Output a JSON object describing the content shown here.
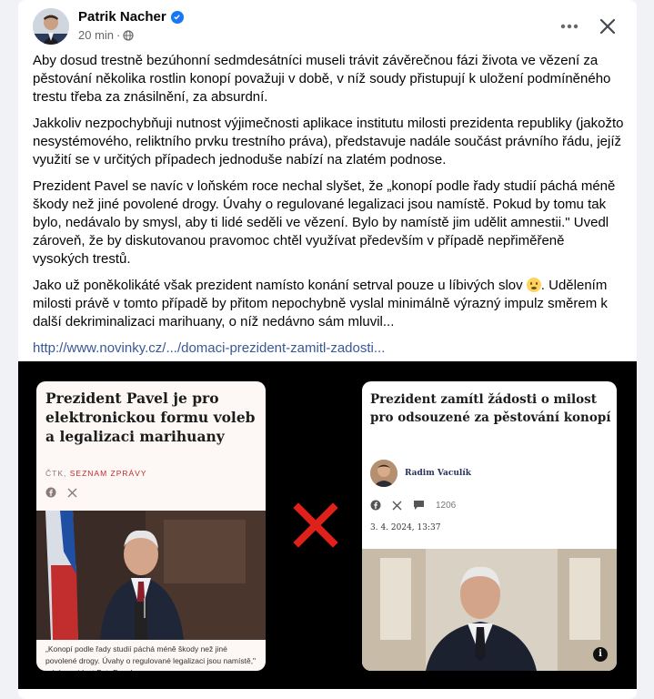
{
  "post": {
    "author": "Patrik Nacher",
    "time": "20 min",
    "meta_separator": "·",
    "paragraphs": [
      "Aby dosud trestně bezúhonní sedmdesátníci museli trávit závěrečnou fázi života ve vězení za pěstování několika rostlin konopí považuji v době, v níž soudy přistupují k uložení podmíněného trestu třeba za znásilnění, za absurdní.",
      "Jakkoliv nezpochybňuji nutnost výjimečnosti aplikace institutu milosti prezidenta republiky (jakožto nesystémového, reliktního prvku trestního práva), představuje nadále součást právního řádu, jejíž využití se v určitých případech jednoduše nabízí na zlatém podnose.",
      "Prezident Pavel se navíc v loňském roce nechal slyšet, že „konopí podle řady studií páchá méně škody než jiné povolené drogy. Úvahy o regulované legalizaci jsou namístě. Pokud by tomu tak bylo, nedávalo by smysl, aby ti lidé seděli ve vězení. Bylo by namístě jim udělit amnestii.\" Uvedl zároveň, že by diskutovanou pravomoc chtěl využívat především v případě nepřiměřeně vysokých trestů."
    ],
    "paragraph4_a": "Jako už poněkolikáté však prezident namísto konání setrval pouze u líbivých slov ",
    "paragraph4_b": ". Udělením milosti právě v tomto případě by přitom nepochybně vyslal minimálně výrazný impulz směrem k další dekriminalizaci marihuany, o níž nedávno sám mluvil...",
    "link": "http://www.novinky.cz/.../domaci-prezident-zamitl-zadosti..."
  },
  "card_left": {
    "title": "Prezident Pavel je pro elektronickou formu voleb a legalizaci marihuany",
    "source_a": "ČTK, ",
    "source_b": "SEZNAM ZPRÁVY",
    "caption": "„Konopí podle řady studií páchá méně škody než jiné povolené drogy. Úvahy o regulované legalizaci jsou namístě,\" míní prezident Petr Pavel."
  },
  "card_right": {
    "title": "Prezident zamítl žádosti o milost pro odsouzené za pěstování konopí",
    "author": "Radim Vaculík",
    "comment_count": "1206",
    "date": "3. 4. 2024, 13:37"
  },
  "colors": {
    "link": "#385898",
    "verified": "#1877f2",
    "cross": "#e0201b",
    "media_bg": "#000000"
  },
  "icons": [
    "verified-badge-icon",
    "globe-icon",
    "more-options-icon",
    "close-icon",
    "facebook-icon",
    "x-twitter-icon",
    "comment-icon",
    "info-icon",
    "red-cross-icon"
  ]
}
